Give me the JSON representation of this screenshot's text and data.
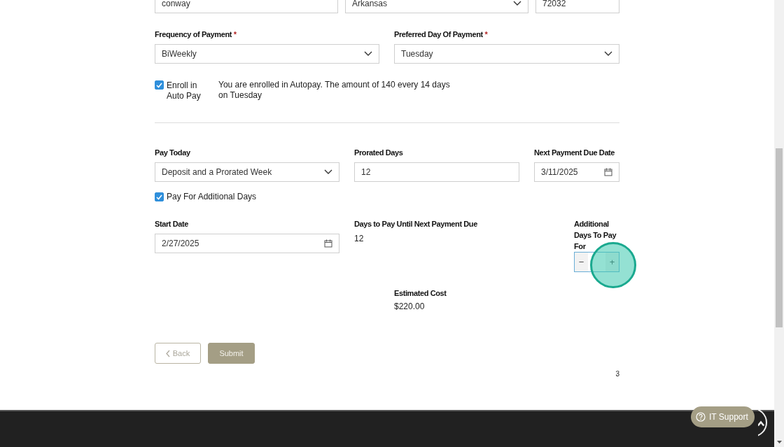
{
  "address_row": [
    {
      "kind": "text",
      "value": "conway"
    },
    {
      "kind": "select",
      "value": "Arkansas"
    },
    {
      "kind": "text",
      "value": "72032"
    }
  ],
  "payment_row": [
    {
      "label": "Frequency of Payment",
      "required_mark": "*",
      "value": "BiWeekly"
    },
    {
      "label": "Preferred Day Of Payment",
      "required_mark": "*",
      "value": "Tuesday"
    }
  ],
  "autopay": {
    "label": "Enroll in Auto Pay",
    "checked": true,
    "message": "You are enrolled in Autopay. The amount of 140 every 14 days on Tuesday"
  },
  "pay_today_row": [
    {
      "label": "Pay Today",
      "kind": "select",
      "value": "Deposit and a Prorated Week"
    },
    {
      "label": "Prorated Days",
      "kind": "text",
      "value": "12"
    },
    {
      "label": "Next Payment Due Date",
      "kind": "date",
      "value": "3/11/2025"
    }
  ],
  "additional_days": {
    "label": "Pay For Additional Days",
    "checked": true
  },
  "start_date": {
    "label": "Start Date",
    "value": "2/27/2025"
  },
  "days_to_pay": {
    "label": "Days to Pay Until Next Payment Due",
    "value": "12"
  },
  "additional_stepper": {
    "label": "Additional Days To Pay For",
    "minus": "−",
    "plus": "+"
  },
  "estimated_cost": {
    "label": "Estimated Cost",
    "value": "$220.00"
  },
  "buttons": [
    {
      "kind": "back",
      "label": "Back"
    },
    {
      "kind": "submit",
      "label": "Submit"
    }
  ],
  "page_number": "3",
  "support_button": {
    "label": "IT Support"
  }
}
